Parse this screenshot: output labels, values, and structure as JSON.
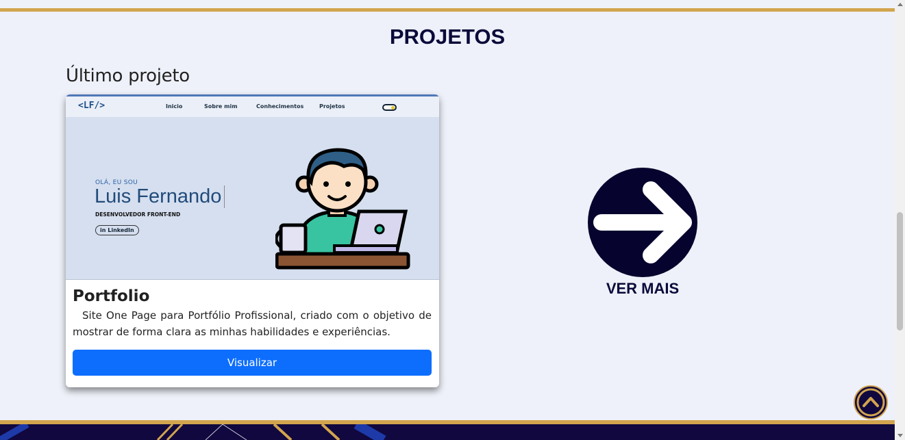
{
  "section": {
    "title": "PROJETOS",
    "subtitle": "Último projeto"
  },
  "project_card": {
    "preview": {
      "logo": "<LF/>",
      "nav_links": [
        "Inicio",
        "Sobre mim",
        "Conhecimentos",
        "Projetos"
      ],
      "greeting": "OLÁ, EU SOU",
      "name": "Luis Fernando",
      "role": "DESENVOLVEDOR FRONT-END",
      "linkedin_label": "in LinkedIn",
      "illustration_icon": "developer-with-laptop-illustration"
    },
    "title": "Portfolio",
    "description": "Site One Page para Portfólio Profissional, criado com o objetivo de mostrar de forma clara as minhas habilidades e experiências.",
    "button_label": "Visualizar"
  },
  "see_more": {
    "icon": "arrow-right-icon",
    "label": "VER MAIS"
  },
  "scroll_top": {
    "icon": "chevron-up-icon"
  },
  "colors": {
    "accent_gold": "#d2a44e",
    "navy": "#10083e",
    "background": "#eef1f9",
    "button_blue": "#0d6efd"
  }
}
